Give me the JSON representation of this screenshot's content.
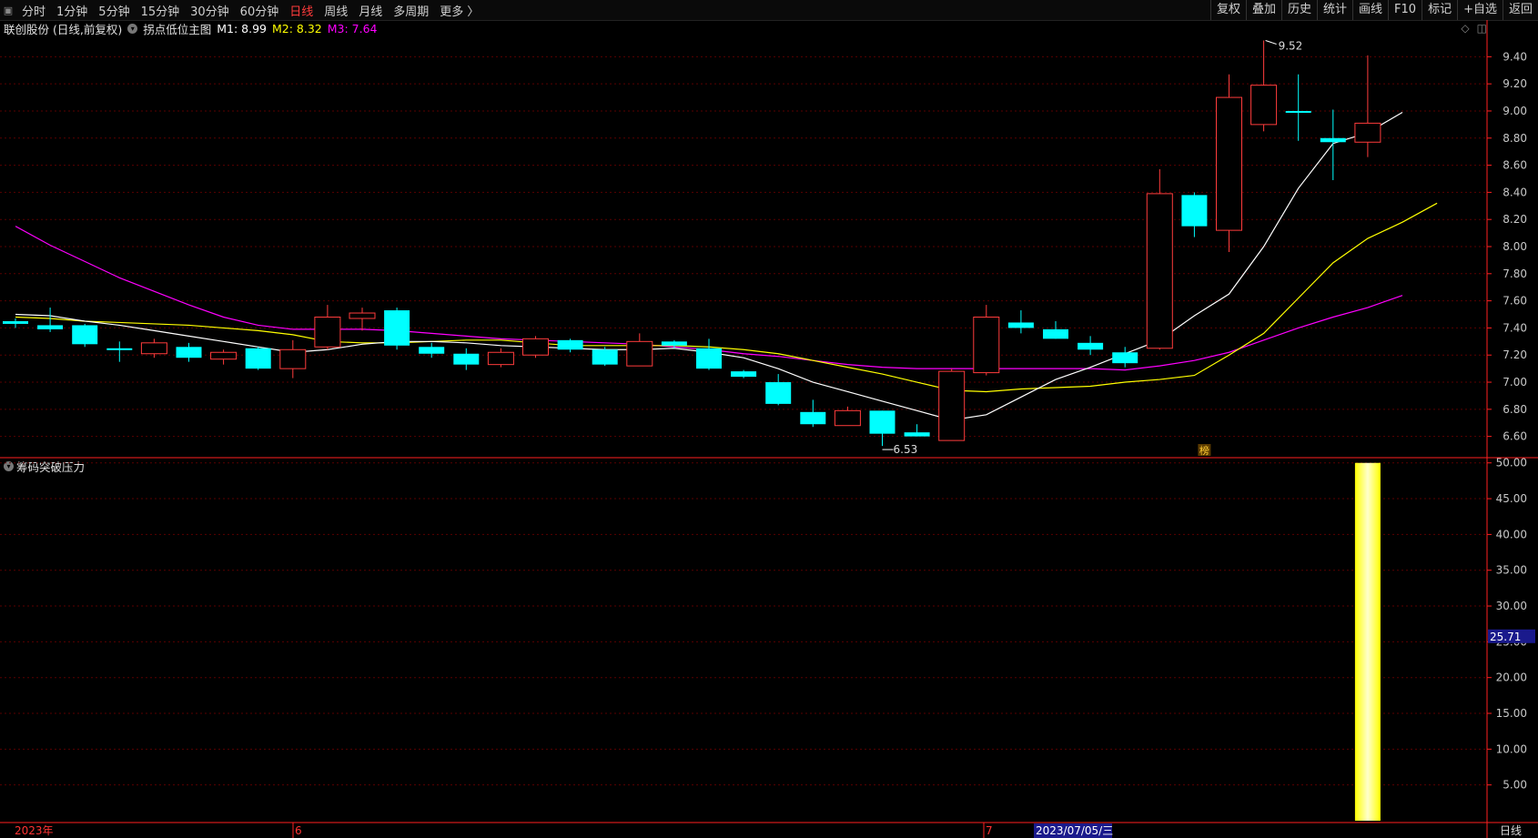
{
  "toolbar": {
    "logo_icon": "menu-toggle-icon",
    "periods": [
      "分时",
      "1分钟",
      "5分钟",
      "15分钟",
      "30分钟",
      "60分钟",
      "日线",
      "周线",
      "月线",
      "多周期",
      "更多 〉"
    ],
    "active_period": "日线",
    "right_buttons": [
      "复权",
      "叠加",
      "历史",
      "统计",
      "画线",
      "F10",
      "标记",
      "+自选",
      "返回"
    ]
  },
  "info": {
    "stock": "联创股份 (日线,前复权)",
    "indicator": "拐点低位主图",
    "m1": "M1: 8.99",
    "m2": "M2: 8.32",
    "m3": "M3: 7.64"
  },
  "indicator_panel": {
    "title": "筹码突破压力"
  },
  "annotations": {
    "high_label": "9.52",
    "low_label": "6.53",
    "bang_label": "榜"
  },
  "xaxis": {
    "label_year": "2023年",
    "label_jun": "6",
    "label_jul": "7",
    "cursor_date": "2023/07/05/三",
    "period_label": "日线"
  },
  "cursor_value": "25.71",
  "colors": {
    "up": "#ff3c3c",
    "down": "#00ffff",
    "ma1": "#ffffff",
    "ma2": "#ffff00",
    "ma3": "#ff00ff",
    "grid": "#5a0000",
    "axis": "#ff2020",
    "bar": "#ffff66"
  },
  "chart_data": [
    {
      "type": "candlestick",
      "ylim": [
        6.45,
        9.55
      ],
      "yticks": [
        6.6,
        6.8,
        7.0,
        7.2,
        7.4,
        7.6,
        7.8,
        8.0,
        8.2,
        8.4,
        8.6,
        8.8,
        9.0,
        9.2,
        9.4
      ],
      "candles": [
        {
          "o": 7.45,
          "h": 7.47,
          "l": 7.4,
          "c": 7.43
        },
        {
          "o": 7.42,
          "h": 7.55,
          "l": 7.37,
          "c": 7.39
        },
        {
          "o": 7.42,
          "h": 7.43,
          "l": 7.26,
          "c": 7.28
        },
        {
          "o": 7.25,
          "h": 7.3,
          "l": 7.15,
          "c": 7.24
        },
        {
          "o": 7.21,
          "h": 7.32,
          "l": 7.18,
          "c": 7.29
        },
        {
          "o": 7.26,
          "h": 7.29,
          "l": 7.15,
          "c": 7.18
        },
        {
          "o": 7.17,
          "h": 7.24,
          "l": 7.13,
          "c": 7.22
        },
        {
          "o": 7.25,
          "h": 7.26,
          "l": 7.09,
          "c": 7.1
        },
        {
          "o": 7.1,
          "h": 7.31,
          "l": 7.03,
          "c": 7.24
        },
        {
          "o": 7.26,
          "h": 7.57,
          "l": 7.24,
          "c": 7.48
        },
        {
          "o": 7.47,
          "h": 7.55,
          "l": 7.38,
          "c": 7.51
        },
        {
          "o": 7.53,
          "h": 7.55,
          "l": 7.24,
          "c": 7.27
        },
        {
          "o": 7.26,
          "h": 7.29,
          "l": 7.18,
          "c": 7.21
        },
        {
          "o": 7.21,
          "h": 7.25,
          "l": 7.09,
          "c": 7.13
        },
        {
          "o": 7.13,
          "h": 7.25,
          "l": 7.11,
          "c": 7.22
        },
        {
          "o": 7.2,
          "h": 7.34,
          "l": 7.18,
          "c": 7.32
        },
        {
          "o": 7.31,
          "h": 7.32,
          "l": 7.22,
          "c": 7.24
        },
        {
          "o": 7.24,
          "h": 7.26,
          "l": 7.12,
          "c": 7.13
        },
        {
          "o": 7.12,
          "h": 7.36,
          "l": 7.12,
          "c": 7.3
        },
        {
          "o": 7.3,
          "h": 7.31,
          "l": 7.25,
          "c": 7.27
        },
        {
          "o": 7.25,
          "h": 7.32,
          "l": 7.09,
          "c": 7.1
        },
        {
          "o": 7.08,
          "h": 7.09,
          "l": 7.03,
          "c": 7.04
        },
        {
          "o": 7.0,
          "h": 7.06,
          "l": 6.83,
          "c": 6.84
        },
        {
          "o": 6.78,
          "h": 6.87,
          "l": 6.67,
          "c": 6.69
        },
        {
          "o": 6.68,
          "h": 6.82,
          "l": 6.68,
          "c": 6.79
        },
        {
          "o": 6.79,
          "h": 6.79,
          "l": 6.53,
          "c": 6.62
        },
        {
          "o": 6.63,
          "h": 6.69,
          "l": 6.6,
          "c": 6.6
        },
        {
          "o": 6.57,
          "h": 7.1,
          "l": 6.57,
          "c": 7.08
        },
        {
          "o": 7.07,
          "h": 7.57,
          "l": 7.05,
          "c": 7.48
        },
        {
          "o": 7.44,
          "h": 7.53,
          "l": 7.36,
          "c": 7.4
        },
        {
          "o": 7.39,
          "h": 7.45,
          "l": 7.32,
          "c": 7.32
        },
        {
          "o": 7.29,
          "h": 7.34,
          "l": 7.2,
          "c": 7.24
        },
        {
          "o": 7.22,
          "h": 7.26,
          "l": 7.11,
          "c": 7.14
        },
        {
          "o": 7.25,
          "h": 8.57,
          "l": 7.24,
          "c": 8.39
        },
        {
          "o": 8.38,
          "h": 8.4,
          "l": 8.07,
          "c": 8.15
        },
        {
          "o": 8.12,
          "h": 9.27,
          "l": 7.96,
          "c": 9.1
        },
        {
          "o": 8.9,
          "h": 9.52,
          "l": 8.85,
          "c": 9.19
        },
        {
          "o": 9.0,
          "h": 9.27,
          "l": 8.78,
          "c": 8.99
        },
        {
          "o": 8.8,
          "h": 9.01,
          "l": 8.49,
          "c": 8.77
        },
        {
          "o": 8.77,
          "h": 9.41,
          "l": 8.66,
          "c": 8.91
        }
      ],
      "ma1": [
        7.5,
        7.49,
        7.45,
        7.42,
        7.38,
        7.34,
        7.3,
        7.26,
        7.22,
        7.24,
        7.28,
        7.3,
        7.3,
        7.29,
        7.27,
        7.26,
        7.25,
        7.24,
        7.24,
        7.25,
        7.22,
        7.18,
        7.1,
        7.0,
        6.93,
        6.86,
        6.79,
        6.72,
        6.76,
        6.89,
        7.02,
        7.11,
        7.21,
        7.31,
        7.49,
        7.65,
        8.0,
        8.43,
        8.76,
        8.84,
        8.99
      ],
      "ma2": [
        7.48,
        7.47,
        7.45,
        7.44,
        7.43,
        7.42,
        7.4,
        7.38,
        7.35,
        7.3,
        7.29,
        7.29,
        7.3,
        7.31,
        7.31,
        7.29,
        7.27,
        7.27,
        7.27,
        7.27,
        7.26,
        7.24,
        7.21,
        7.16,
        7.11,
        7.06,
        7.0,
        6.94,
        6.93,
        6.95,
        6.96,
        6.97,
        7.0,
        7.02,
        7.05,
        7.2,
        7.36,
        7.62,
        7.88,
        8.06,
        8.18,
        8.32
      ],
      "ma3": [
        8.15,
        8.01,
        7.89,
        7.77,
        7.67,
        7.57,
        7.48,
        7.42,
        7.39,
        7.39,
        7.39,
        7.38,
        7.36,
        7.34,
        7.32,
        7.31,
        7.3,
        7.29,
        7.28,
        7.26,
        7.24,
        7.21,
        7.19,
        7.16,
        7.13,
        7.11,
        7.1,
        7.1,
        7.1,
        7.1,
        7.1,
        7.1,
        7.09,
        7.12,
        7.16,
        7.22,
        7.31,
        7.4,
        7.48,
        7.55,
        7.64
      ]
    },
    {
      "type": "bar",
      "ylim": [
        0,
        52
      ],
      "yticks": [
        5.0,
        10.0,
        15.0,
        20.0,
        25.0,
        30.0,
        35.0,
        40.0,
        45.0,
        50.0
      ],
      "bar_index": 39,
      "bar_value": 50.0
    }
  ]
}
